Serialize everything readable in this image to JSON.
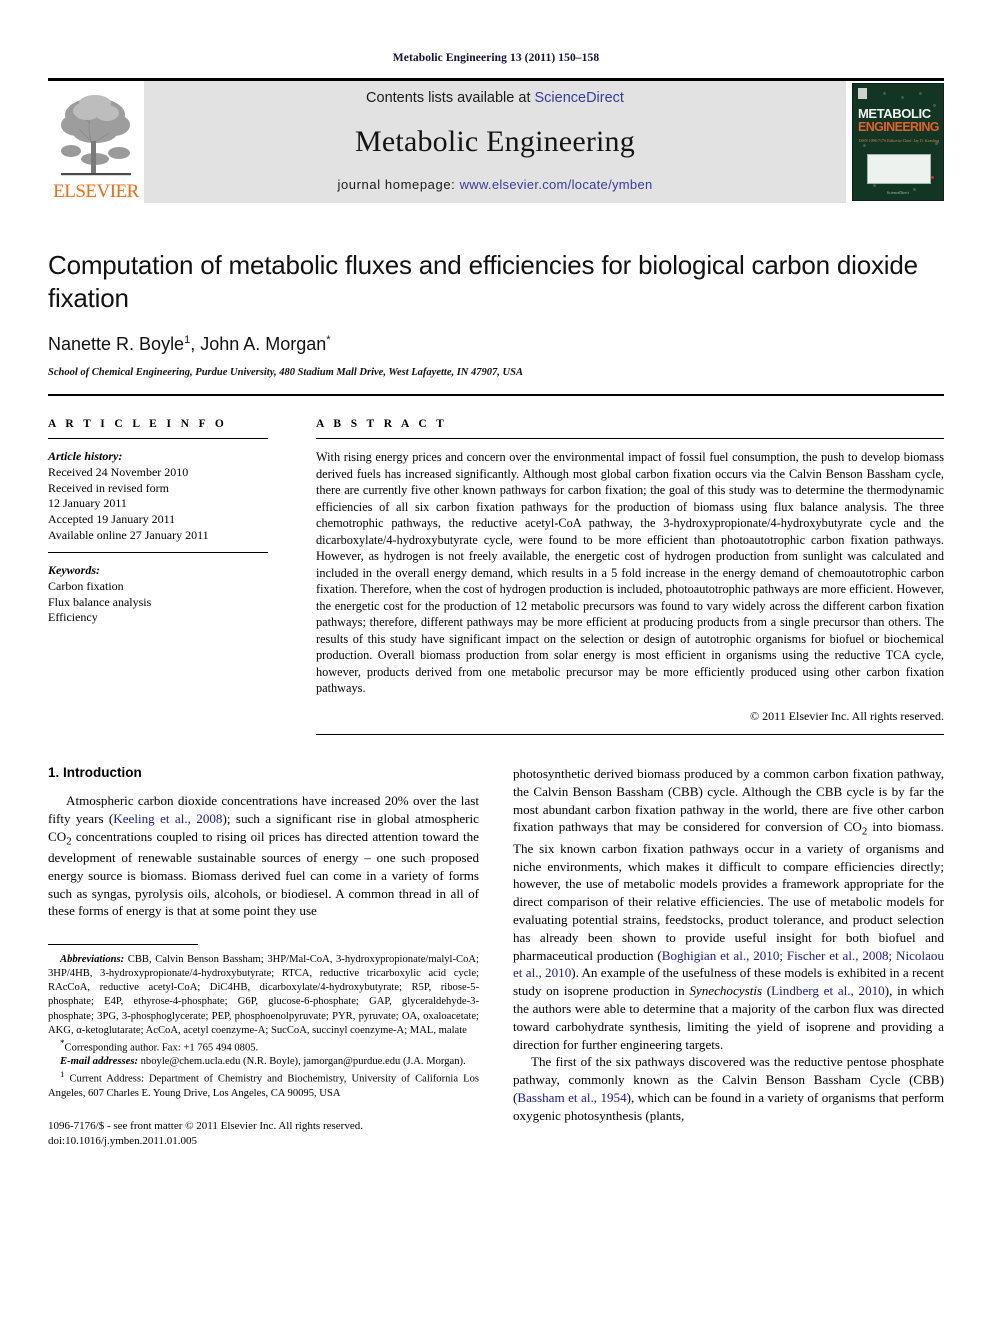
{
  "running_head": "Metabolic Engineering 13 (2011) 150–158",
  "masthead": {
    "publisher_name": "ELSEVIER",
    "contents_prefix": "Contents lists available at",
    "contents_link": "ScienceDirect",
    "journal_name": "Metabolic Engineering",
    "homepage_prefix": "journal homepage:",
    "homepage_url": "www.elsevier.com/locate/ymben",
    "cover": {
      "title_line1": "METABOLIC",
      "title_line2": "ENGINEERING",
      "subtitle": "ISSN 1096-7176\nEditor-in-Chief: Jay D. Keasling",
      "footer": "ScienceDirect"
    },
    "link_color": "#3a3a9c"
  },
  "article": {
    "title": "Computation of metabolic fluxes and efficiencies for biological carbon dioxide fixation",
    "authors_pre": "Nanette R. Boyle",
    "authors_sup1": "1",
    "authors_mid": ", John A. Morgan",
    "authors_sup2": "*",
    "affiliation": "School of Chemical Engineering, Purdue University, 480 Stadium Mall Drive, West Lafayette, IN 47907, USA"
  },
  "article_info": {
    "heading": "A R T I C L E   I N F O",
    "history_label": "Article history:",
    "history": [
      "Received 24 November 2010",
      "Received in revised form",
      "12 January 2011",
      "Accepted 19 January 2011",
      "Available online 27 January 2011"
    ],
    "keywords_label": "Keywords:",
    "keywords": [
      "Carbon fixation",
      "Flux balance analysis",
      "Efficiency"
    ]
  },
  "abstract": {
    "heading": "A B S T R A C T",
    "text": "With rising energy prices and concern over the environmental impact of fossil fuel consumption, the push to develop biomass derived fuels has increased significantly. Although most global carbon fixation occurs via the Calvin Benson Bassham cycle, there are currently five other known pathways for carbon fixation; the goal of this study was to determine the thermodynamic efficiencies of all six carbon fixation pathways for the production of biomass using flux balance analysis. The three chemotrophic pathways, the reductive acetyl-CoA pathway, the 3-hydroxypropionate/4-hydroxybutyrate cycle and the dicarboxylate/4-hydroxybutyrate cycle, were found to be more efficient than photoautotrophic carbon fixation pathways. However, as hydrogen is not freely available, the energetic cost of hydrogen production from sunlight was calculated and included in the overall energy demand, which results in a 5 fold increase in the energy demand of chemoautotrophic carbon fixation. Therefore, when the cost of hydrogen production is included, photoautotrophic pathways are more efficient. However, the energetic cost for the production of 12 metabolic precursors was found to vary widely across the different carbon fixation pathways; therefore, different pathways may be more efficient at producing products from a single precursor than others. The results of this study have significant impact on the selection or design of autotrophic organisms for biofuel or biochemical production. Overall biomass production from solar energy is most efficient in organisms using the reductive TCA cycle, however, products derived from one metabolic precursor may be more efficiently produced using other carbon fixation pathways.",
    "copyright": "© 2011 Elsevier Inc. All rights reserved."
  },
  "introduction": {
    "heading": "1.  Introduction",
    "left_para_1_a": "Atmospheric carbon dioxide concentrations have increased 20% over the last fifty years (",
    "left_para_1_ref": "Keeling et al., 2008",
    "left_para_1_b": "); such a significant rise in global atmospheric CO",
    "left_para_1_sub": "2",
    "left_para_1_c": " concentrations coupled to rising oil prices has directed attention toward the development of renewable sustainable sources of energy – one such proposed energy source is biomass. Biomass derived fuel can come in a variety of forms such as syngas, pyrolysis oils, alcohols, or biodiesel. A common thread in all of these forms of energy is that at some point they use",
    "right_para_1_a": "photosynthetic derived biomass produced by a common carbon fixation pathway, the Calvin Benson Bassham (CBB) cycle. Although the CBB cycle is by far the most abundant carbon fixation pathway in the world, there are five other carbon fixation pathways that may be considered for conversion of CO",
    "right_para_1_sub": "2",
    "right_para_1_b": " into biomass. The six known carbon fixation pathways occur in a variety of organisms and niche environments, which makes it difficult to compare efficiencies directly; however, the use of metabolic models provides a framework appropriate for the direct comparison of their relative efficiencies. The use of metabolic models for evaluating potential strains, feedstocks, product tolerance, and product selection has already been shown to provide useful insight for both biofuel and pharmaceutical production (",
    "right_para_1_ref1": "Boghigian et al., 2010; Fischer et al., 2008; Nicolaou et al., 2010",
    "right_para_1_c": "). An example of the usefulness of these models is exhibited in a recent study on isoprene production in ",
    "right_para_1_ital": "Synechocystis",
    "right_para_1_d": " (",
    "right_para_1_ref2": "Lindberg et al., 2010",
    "right_para_1_e": "), in which the authors were able to determine that a majority of the carbon flux was directed toward carbohydrate synthesis, limiting the yield of isoprene and providing a direction for further engineering targets.",
    "right_para_2_a": "The first of the six pathways discovered was the reductive pentose phosphate pathway, commonly known as the Calvin Benson Bassham Cycle (CBB) (",
    "right_para_2_ref": "Bassham et al., 1954",
    "right_para_2_b": "), which can be found in a variety of organisms that perform oxygenic photosynthesis (plants,"
  },
  "footnotes": {
    "abbreviations_label": "Abbreviations:",
    "abbreviations_text": " CBB, Calvin Benson Bassham; 3HP/Mal-CoA, 3-hydroxypropionate/malyl-CoA; 3HP/4HB, 3-hydroxypropionate/4-hydroxybutyrate; RTCA, reductive tricarboxylic acid cycle; RAcCoA, reductive acetyl-CoA; DiC4HB, dicarboxylate/4-hydroxybutyrate; R5P, ribose-5-phosphate; E4P, ethyrose-4-phosphate; G6P, glucose-6-phosphate; GAP, glyceraldehyde-3-phosphate; 3PG, 3-phosphoglycerate; PEP, phosphoenolpyruvate; PYR, pyruvate; OA, oxaloacetate; AKG, α-ketoglutarate; AcCoA, acetyl coenzyme-A; SucCoA, succinyl coenzyme-A; MAL, malate",
    "corresponding": "Corresponding author. Fax: +1 765 494 0805.",
    "email_label": "E-mail addresses:",
    "email_text": " nboyle@chem.ucla.edu (N.R. Boyle), jamorgan@purdue.edu (J.A. Morgan).",
    "current_address_sup": "1",
    "current_address": " Current Address: Department of Chemistry and Biochemistry, University of California Los Angeles, 607 Charles E. Young Drive, Los Angeles, CA 90095, USA"
  },
  "imprint": {
    "line1": "1096-7176/$ - see front matter © 2011 Elsevier Inc. All rights reserved.",
    "line2": "doi:10.1016/j.ymben.2011.01.005"
  }
}
